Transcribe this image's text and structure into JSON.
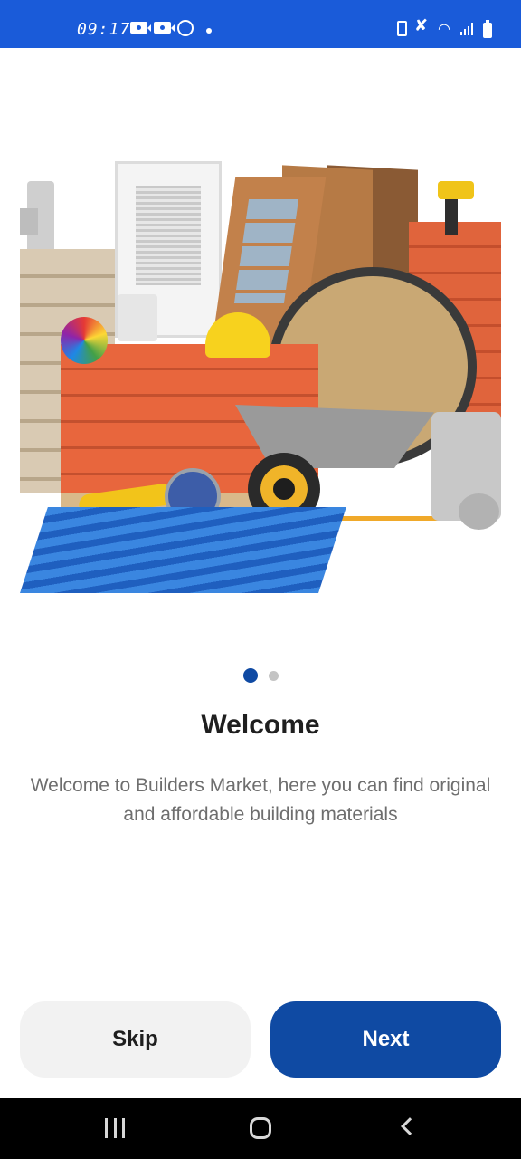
{
  "status_bar": {
    "time": "09:17",
    "left_icons": [
      "video-camera-icon",
      "video-camera-icon",
      "whatsapp-icon",
      "notification-dot-icon"
    ],
    "right_icons": [
      "battery-saver-icon",
      "mute-icon",
      "wifi-icon",
      "signal-icon",
      "battery-icon"
    ],
    "wifi_glyph": "◠",
    "mute_glyph": "✘"
  },
  "hero": {
    "illustration": "building-materials-illustration",
    "alt": "Building materials: bricks, cement bags, doors, window, cable reel, wheelbarrow, drill, grinder, helmet, pipes, metal roofing sheets"
  },
  "onboarding": {
    "page_indicator": {
      "total": 2,
      "current": 1
    },
    "title": "Welcome",
    "description": "Welcome to Builders Market, here you can find original and affordable building materials"
  },
  "actions": {
    "skip_label": "Skip",
    "next_label": "Next"
  },
  "colors": {
    "status_bar": "#1a5bd9",
    "primary": "#0f4aa3",
    "skip_bg": "#f2f2f2",
    "indicator_inactive": "#c4c4c4"
  },
  "nav_bar": {
    "buttons": [
      "recent-apps",
      "home",
      "back"
    ]
  }
}
